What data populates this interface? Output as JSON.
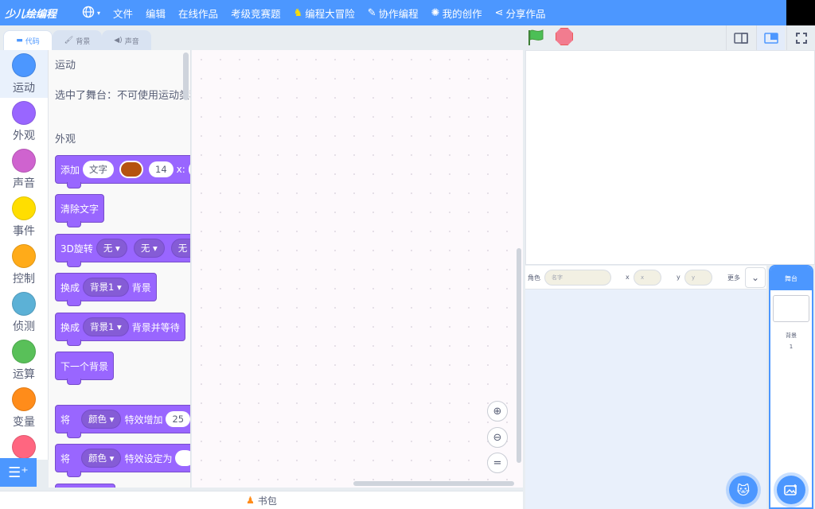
{
  "topbar": {
    "logo": "少儿绘编程",
    "language_icon": "globe-icon",
    "menu": [
      {
        "label": "文件"
      },
      {
        "label": "编辑"
      },
      {
        "label": "在线作品"
      },
      {
        "label": "考级竞赛题"
      },
      {
        "label": "编程大冒险",
        "icon": "bird-icon"
      },
      {
        "label": "协作编程",
        "icon": "pen-icon"
      },
      {
        "label": "我的创作",
        "icon": "lightbulb-icon"
      },
      {
        "label": "分享作品",
        "icon": "share-icon"
      }
    ]
  },
  "tabs": [
    {
      "label": "代码",
      "icon": "code-icon"
    },
    {
      "label": "背景",
      "icon": "brush-icon"
    },
    {
      "label": "声音",
      "icon": "speaker-icon"
    }
  ],
  "categories": [
    {
      "label": "运动",
      "color": "#4c97ff"
    },
    {
      "label": "外观",
      "color": "#9966ff"
    },
    {
      "label": "声音",
      "color": "#cf63cf"
    },
    {
      "label": "事件",
      "color": "#ffde00"
    },
    {
      "label": "控制",
      "color": "#ffab19"
    },
    {
      "label": "侦测",
      "color": "#5cb1d6"
    },
    {
      "label": "运算",
      "color": "#59c059"
    },
    {
      "label": "变量",
      "color": "#ff8c1a"
    },
    {
      "label": "",
      "color": "#ff6680"
    }
  ],
  "palette": {
    "motion_heading": "运动",
    "motion_note": "选中了舞台：不可使用运动类积木",
    "looks_heading": "外观",
    "blocks": {
      "add_text": {
        "label": "添加",
        "text": "文字",
        "size": "14",
        "x_label": "x:"
      },
      "clear_text": {
        "label": "清除文字"
      },
      "rotate3d": {
        "label": "3D旋转",
        "opt1": "无",
        "opt2": "无",
        "opt3": "无"
      },
      "switch_backdrop": {
        "label": "换成",
        "backdrop": "背景1",
        "suffix": "背景"
      },
      "switch_backdrop_wait": {
        "label": "换成",
        "backdrop": "背景1",
        "suffix": "背景并等待"
      },
      "next_backdrop": {
        "label": "下一个背景"
      },
      "change_effect": {
        "label": "将",
        "effect": "颜色",
        "suffix": "特效增加",
        "value": "25"
      },
      "set_effect": {
        "label": "将",
        "effect": "颜色",
        "suffix": "特效设定为"
      }
    }
  },
  "workspace": {
    "zoom_in": "+",
    "zoom_out": "−",
    "reset": "="
  },
  "bottom": {
    "backpack_label": "书包"
  },
  "sprite_info": {
    "sprite_label": "角色",
    "name_placeholder": "名字",
    "x_label": "x",
    "x_placeholder": "x",
    "y_label": "y",
    "y_placeholder": "y",
    "more_label": "更多"
  },
  "stage_panel": {
    "header": "舞台",
    "backdrops_label": "背景",
    "backdrops_count": "1"
  },
  "colors": {
    "accent": "#4c97ff",
    "looks": "#9966ff",
    "flag": "#45993d",
    "stop": "#f27c8f"
  }
}
